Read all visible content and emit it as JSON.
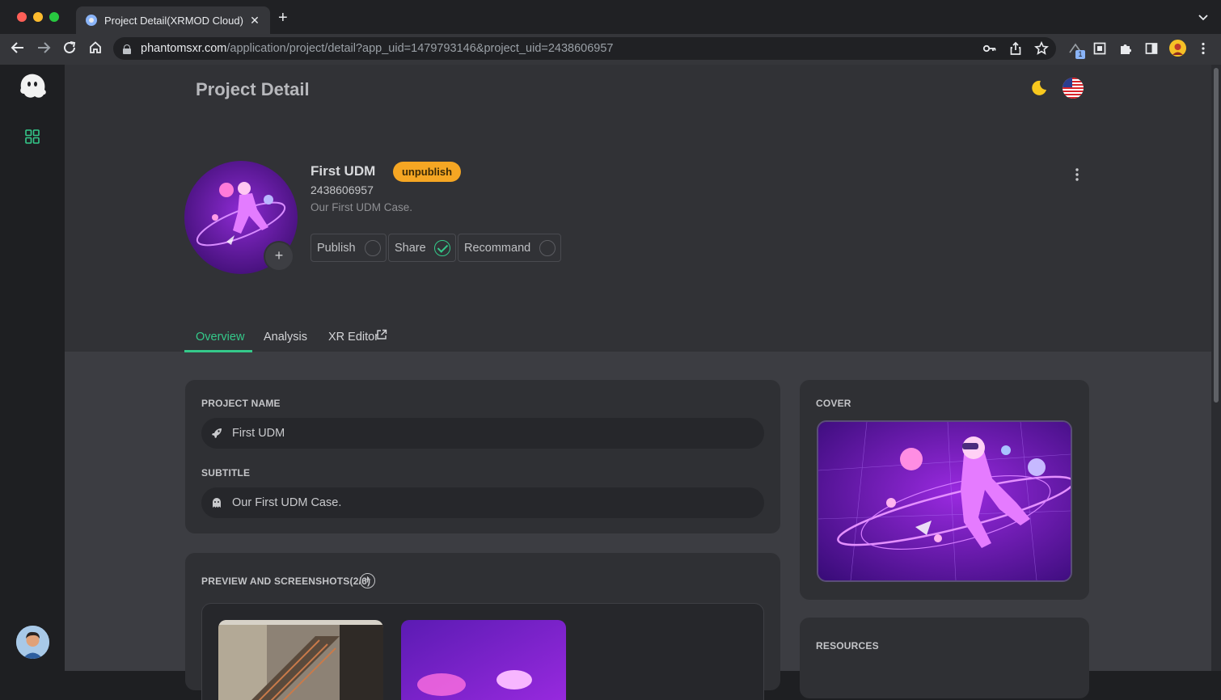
{
  "browser": {
    "tab_title": "Project Detail(XRMOD Cloud) -",
    "tab_close": "✕",
    "new_tab": "+",
    "url_host": "phantomsxr.com",
    "url_path": "/application/project/detail?app_uid=1479793146&project_uid=2438606957",
    "ext_badge": "1"
  },
  "page": {
    "title": "Project Detail"
  },
  "project": {
    "name": "First UDM",
    "status": "unpublish",
    "id": "2438606957",
    "description": "Our First UDM Case.",
    "avatar_add": "+",
    "toggles": [
      {
        "label": "Publish",
        "checked": false
      },
      {
        "label": "Share",
        "checked": true
      },
      {
        "label": "Recommand",
        "checked": false
      }
    ]
  },
  "tabs": [
    {
      "label": "Overview",
      "active": true
    },
    {
      "label": "Analysis",
      "active": false
    },
    {
      "label": "XR Editor",
      "active": false
    }
  ],
  "form": {
    "project_name_label": "PROJECT NAME",
    "project_name_value": "First UDM",
    "subtitle_label": "SUBTITLE",
    "subtitle_value": "Our First UDM Case."
  },
  "preview": {
    "label": "PREVIEW AND SCREENSHOTS(2/6)",
    "add": "+"
  },
  "cover": {
    "label": "COVER"
  },
  "resources": {
    "label": "RESOURCES"
  },
  "colors": {
    "accent": "#34c98a",
    "badge": "#f5a623",
    "background": "#27282c",
    "card": "#2f3034"
  },
  "icons": [
    "ghost-logo-icon",
    "apps-grid-icon",
    "moon-icon",
    "us-flag-icon",
    "kebab-menu-icon",
    "external-link-icon",
    "rocket-icon",
    "ghost-small-icon",
    "plus-circle-icon"
  ]
}
